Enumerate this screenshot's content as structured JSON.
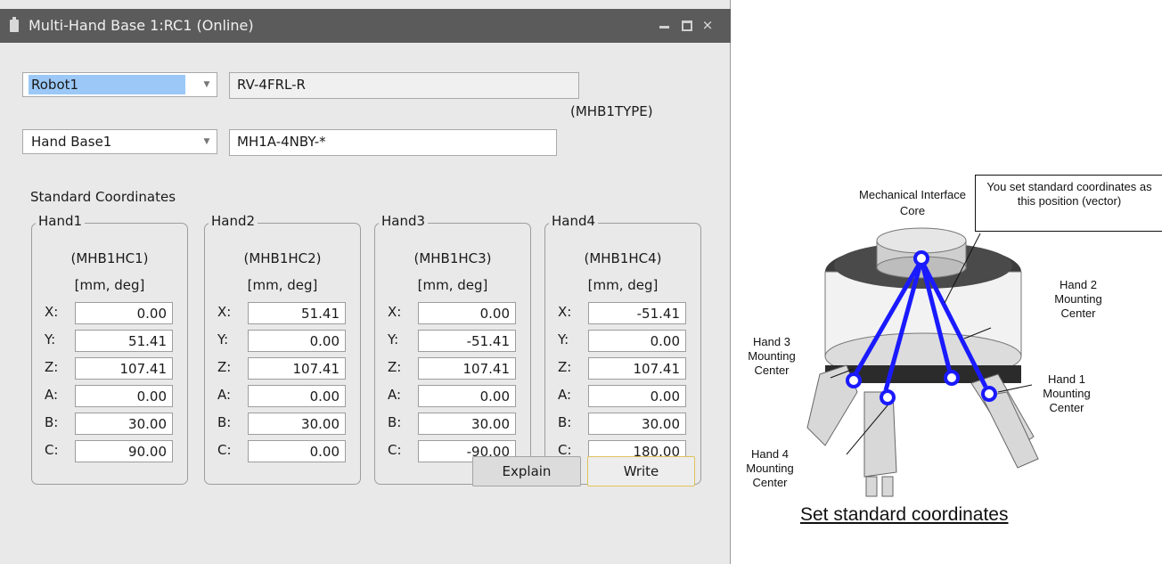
{
  "window": {
    "title": "Multi-Hand Base 1:RC1 (Online)",
    "controls": {
      "minimize": "minimize",
      "maximize": "maximize",
      "close": "×"
    }
  },
  "robot_select": {
    "value": "Robot1",
    "model": "RV-4FRL-R"
  },
  "hand_base_select": {
    "value": "Hand Base1",
    "model": "MH1A-4NBY-*",
    "type_label": "(MHB1TYPE)"
  },
  "standard_coordinates_label": "Standard Coordinates",
  "unit_label": "[mm, deg]",
  "hands": [
    {
      "title": "Hand1",
      "code": "(MHB1HC1)",
      "rows": [
        {
          "axis": "X:",
          "value": "0.00"
        },
        {
          "axis": "Y:",
          "value": "51.41"
        },
        {
          "axis": "Z:",
          "value": "107.41"
        },
        {
          "axis": "A:",
          "value": "0.00"
        },
        {
          "axis": "B:",
          "value": "30.00"
        },
        {
          "axis": "C:",
          "value": "90.00"
        }
      ]
    },
    {
      "title": "Hand2",
      "code": "(MHB1HC2)",
      "rows": [
        {
          "axis": "X:",
          "value": "51.41"
        },
        {
          "axis": "Y:",
          "value": "0.00"
        },
        {
          "axis": "Z:",
          "value": "107.41"
        },
        {
          "axis": "A:",
          "value": "0.00"
        },
        {
          "axis": "B:",
          "value": "30.00"
        },
        {
          "axis": "C:",
          "value": "0.00"
        }
      ]
    },
    {
      "title": "Hand3",
      "code": "(MHB1HC3)",
      "rows": [
        {
          "axis": "X:",
          "value": "0.00"
        },
        {
          "axis": "Y:",
          "value": "-51.41"
        },
        {
          "axis": "Z:",
          "value": "107.41"
        },
        {
          "axis": "A:",
          "value": "0.00"
        },
        {
          "axis": "B:",
          "value": "30.00"
        },
        {
          "axis": "C:",
          "value": "-90.00"
        }
      ]
    },
    {
      "title": "Hand4",
      "code": "(MHB1HC4)",
      "rows": [
        {
          "axis": "X:",
          "value": "-51.41"
        },
        {
          "axis": "Y:",
          "value": "0.00"
        },
        {
          "axis": "Z:",
          "value": "107.41"
        },
        {
          "axis": "A:",
          "value": "0.00"
        },
        {
          "axis": "B:",
          "value": "30.00"
        },
        {
          "axis": "C:",
          "value": "180.00"
        }
      ]
    }
  ],
  "buttons": {
    "explain": "Explain",
    "write": "Write"
  },
  "diagram": {
    "mechanical_interface": "Mechanical Interface",
    "core": "Core",
    "callout": "You set standard coordinates as this position (vector)",
    "hand1": "Hand 1 Mounting Center",
    "hand2": "Hand 2 Mounting Center",
    "hand3": "Hand 3 Mounting Center",
    "hand4": "Hand 4 Mounting Center",
    "caption": "Set standard coordinates",
    "arrow_color": "#1a1aff"
  }
}
